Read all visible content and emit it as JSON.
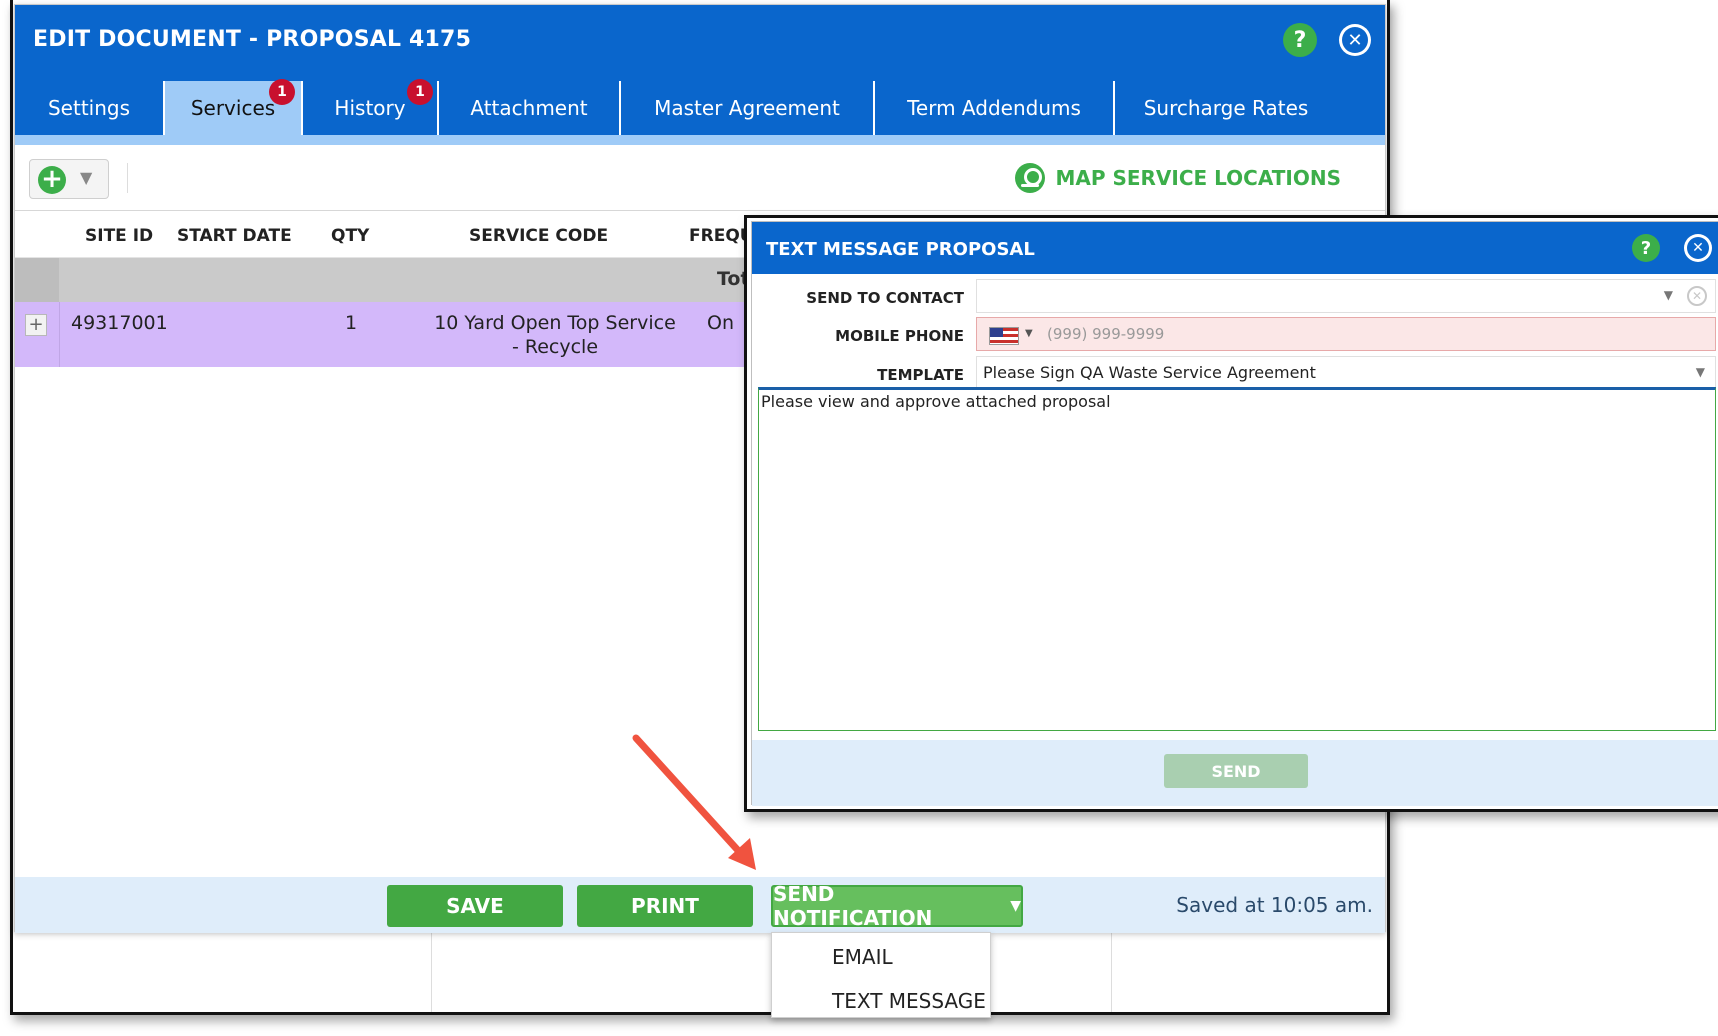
{
  "editor": {
    "title": "EDIT DOCUMENT - PROPOSAL 4175",
    "help_label": "?",
    "tabs": [
      {
        "label": "Settings"
      },
      {
        "label": "Services",
        "badge": "1"
      },
      {
        "label": "History",
        "badge": "1"
      },
      {
        "label": "Attachment"
      },
      {
        "label": "Master Agreement"
      },
      {
        "label": "Term Addendums"
      },
      {
        "label": "Surcharge Rates"
      }
    ],
    "active_tab": "Services",
    "toolbar": {
      "add_label": "+",
      "map_label": "MAP SERVICE LOCATIONS"
    },
    "grid": {
      "columns": [
        "SITE ID",
        "START DATE",
        "QTY",
        "SERVICE CODE",
        "FREQU"
      ],
      "group_label": "Tot",
      "rows": [
        {
          "site_id": "49317001",
          "start_date": "",
          "qty": "1",
          "service_code_line1": "10 Yard Open Top Service",
          "service_code_line2": "- Recycle",
          "frequency": "On"
        }
      ]
    },
    "footer": {
      "save_label": "SAVE",
      "print_label": "PRINT",
      "send_notification_label": "SEND NOTIFICATION",
      "saved_text": "Saved at 10:05 am."
    },
    "notification_menu": [
      "EMAIL",
      "TEXT MESSAGE"
    ]
  },
  "sms_dialog": {
    "title": "TEXT MESSAGE PROPOSAL",
    "help_label": "?",
    "send_to_contact_label": "SEND TO CONTACT",
    "send_to_contact_value": "",
    "mobile_phone_label": "MOBILE PHONE",
    "mobile_phone_placeholder": "(999) 999-9999",
    "template_label": "TEMPLATE",
    "template_value": "Please Sign QA Waste Service Agreement",
    "message": "Please view and approve attached proposal",
    "send_label": "SEND"
  },
  "colors": {
    "header_blue": "#0a66cc",
    "active_tab": "#9fcbf7",
    "green": "#43a843",
    "row_highlight": "#d3b8fa",
    "annotation_arrow": "#f0533f"
  }
}
